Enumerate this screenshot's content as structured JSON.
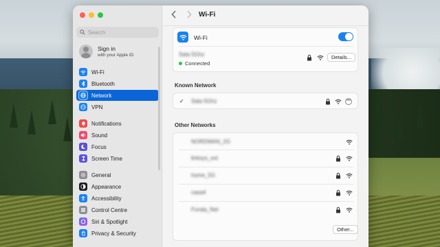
{
  "window": {
    "title": "Wi-Fi"
  },
  "sidebar": {
    "search_placeholder": "Search",
    "account": {
      "name": "Sign in",
      "subtitle": "with your Apple ID"
    },
    "groups": [
      [
        {
          "label": "Wi-Fi",
          "icon": "wifi-icon",
          "color": "#1a82f0",
          "glyph": "◡"
        },
        {
          "label": "Bluetooth",
          "icon": "bluetooth-icon",
          "color": "#1a82f0",
          "glyph": "✱"
        },
        {
          "label": "Network",
          "icon": "globe-icon",
          "color": "#1a82f0",
          "glyph": "◎",
          "active": true
        },
        {
          "label": "VPN",
          "icon": "vpn-icon",
          "color": "#1a82f0",
          "glyph": "▣"
        }
      ],
      [
        {
          "label": "Notifications",
          "icon": "bell-icon",
          "color": "#ef4a4a",
          "glyph": "▲"
        },
        {
          "label": "Sound",
          "icon": "speaker-icon",
          "color": "#ef4a6a",
          "glyph": "◀"
        },
        {
          "label": "Focus",
          "icon": "moon-icon",
          "color": "#5a52d8",
          "glyph": "☾"
        },
        {
          "label": "Screen Time",
          "icon": "hourglass-icon",
          "color": "#5a52d8",
          "glyph": "⧖"
        }
      ],
      [
        {
          "label": "General",
          "icon": "gear-icon",
          "color": "#8e8e93",
          "glyph": "⚙"
        },
        {
          "label": "Appearance",
          "icon": "appearance-icon",
          "color": "#1c1c1e",
          "glyph": "◐"
        },
        {
          "label": "Accessibility",
          "icon": "accessibility-icon",
          "color": "#1a82f0",
          "glyph": "☺"
        },
        {
          "label": "Control Centre",
          "icon": "control-centre-icon",
          "color": "#8e8e93",
          "glyph": "▤"
        },
        {
          "label": "Siri & Spotlight",
          "icon": "siri-icon",
          "color": "#a24be0",
          "glyph": "◉"
        },
        {
          "label": "Privacy & Security",
          "icon": "hand-icon",
          "color": "#1a82f0",
          "glyph": "✋"
        }
      ]
    ]
  },
  "wifi": {
    "label": "Wi-Fi",
    "enabled": true,
    "current_network": "Sala 5Ghz",
    "status": "Connected",
    "details_label": "Details..."
  },
  "known_networks": {
    "title": "Known Network",
    "items": [
      {
        "name": "Sala 5Ghz",
        "locked": true
      }
    ]
  },
  "other_networks": {
    "title": "Other Networks",
    "items": [
      {
        "name": "NORDWAN_2G",
        "locked": false
      },
      {
        "name": "linksys_ext",
        "locked": true
      },
      {
        "name": "home_5G",
        "locked": true
      },
      {
        "name": "casa4",
        "locked": true
      },
      {
        "name": "Fonda_Net",
        "locked": true
      }
    ],
    "other_label": "Other..."
  },
  "colors": {
    "accent": "#0a66d8",
    "wifi_blue": "#1a82f0",
    "connected": "#28c840"
  }
}
